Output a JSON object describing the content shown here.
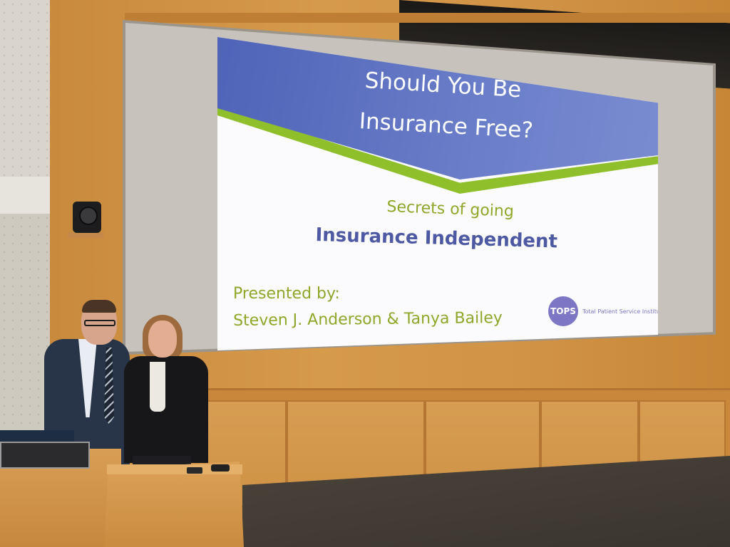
{
  "slide": {
    "title_line1": "Should You Be",
    "title_line2": "Insurance Free?",
    "subtitle_line1": "Secrets of going",
    "subtitle_line2": "Insurance Independent",
    "presented_by": "Presented by:",
    "presenters": "Steven J. Anderson & Tanya Bailey",
    "logo_mark": "TOPS",
    "logo_name": "Total Patient Service Institute"
  },
  "colors": {
    "slide_band": "#5a6dbf",
    "slide_accent_green": "#8fbf2b",
    "slide_text_green": "#8ea72a",
    "slide_text_blue": "#4d5aa3",
    "logo_purple": "#7d76c4",
    "wood_paneling": "#d19346"
  }
}
